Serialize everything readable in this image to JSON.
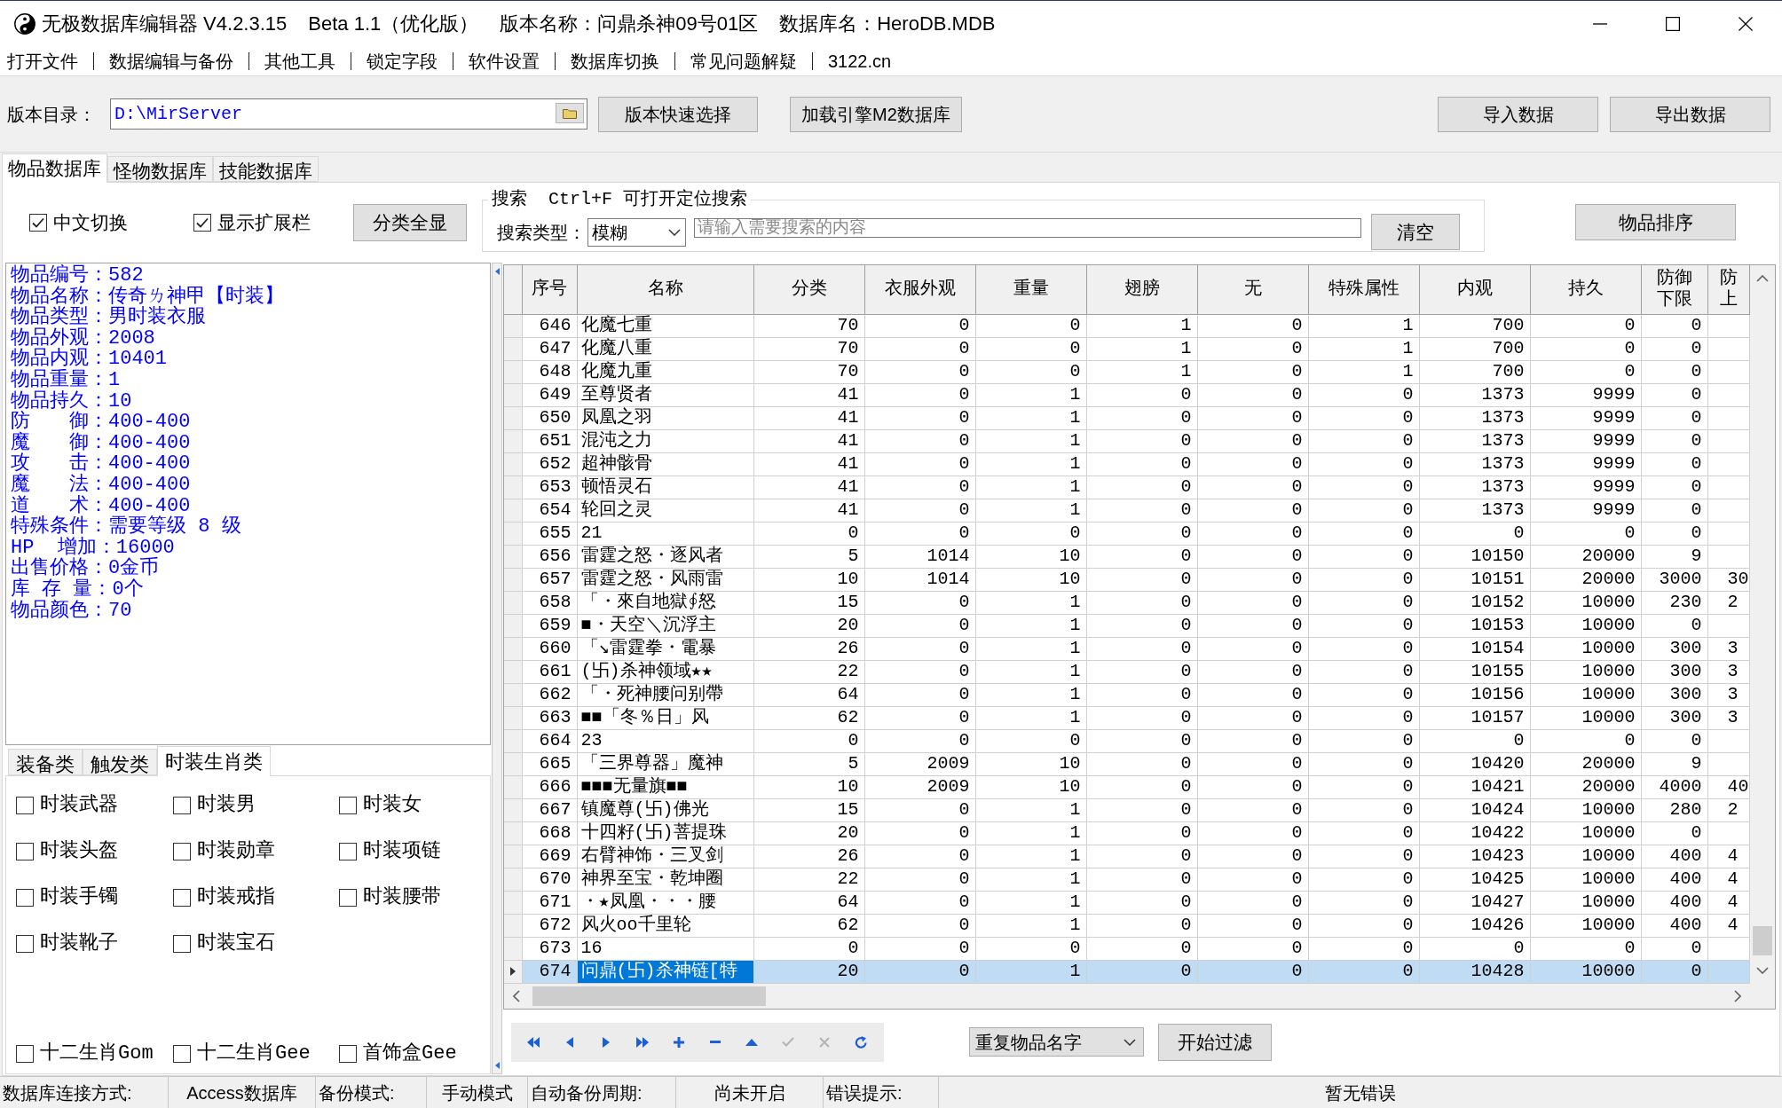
{
  "window": {
    "title_parts": [
      "无极数据库编辑器 V4.2.3.15",
      "Beta 1.1（优化版）",
      "版本名称：问鼎杀神09号01区",
      "数据库名：HeroDB.MDB"
    ]
  },
  "menu": [
    "打开文件",
    "数据编辑与备份",
    "其他工具",
    "锁定字段",
    "软件设置",
    "数据库切换",
    "常见问题解疑",
    "3122.cn"
  ],
  "path_bar": {
    "label": "版本目录：",
    "value": "D:\\MirServer",
    "buttons": [
      "版本快速选择",
      "加载引擎M2数据库"
    ],
    "right_buttons": [
      "导入数据",
      "导出数据"
    ]
  },
  "tabs": [
    {
      "label": "物品数据库",
      "selected": true
    },
    {
      "label": "怪物数据库",
      "selected": false
    },
    {
      "label": "技能数据库",
      "selected": false
    }
  ],
  "options": {
    "checkboxes": [
      {
        "label": "中文切换",
        "checked": true
      },
      {
        "label": "显示扩展栏",
        "checked": true
      }
    ],
    "button": "分类全显"
  },
  "search": {
    "title": "搜索  Ctrl+F 可打开定位搜索",
    "type_label": "搜索类型：",
    "type_value": "模糊",
    "placeholder": "请输入需要搜索的内容",
    "clear_button": "清空"
  },
  "sort_button": "物品排序",
  "item_info": [
    "物品编号：582",
    "物品名称：传奇ㄌ神甲【时装】",
    "物品类型：男时装衣服",
    "物品外观：2008",
    "物品内观：10401",
    "物品重量：1",
    "物品持久：10",
    "防　　御：400-400",
    "魔　　御：400-400",
    "攻　　击：400-400",
    "魔　　法：400-400",
    "道　　术：400-400",
    "特殊条件：需要等级 8 级",
    "HP  增加：16000",
    "出售价格：0金币",
    "库 存 量：0个",
    "物品颜色：70"
  ],
  "category_tabs": [
    {
      "label": "装备类",
      "selected": false
    },
    {
      "label": "触发类",
      "selected": false
    },
    {
      "label": "时装生肖类",
      "selected": true
    }
  ],
  "category_checkbox_groups": [
    [
      {
        "label": "时装武器",
        "checked": false
      },
      {
        "label": "时装男",
        "checked": false
      },
      {
        "label": "时装女",
        "checked": false
      },
      {
        "label": "时装头盔",
        "checked": false
      },
      {
        "label": "时装勋章",
        "checked": false
      },
      {
        "label": "时装项链",
        "checked": false
      },
      {
        "label": "时装手镯",
        "checked": false
      },
      {
        "label": "时装戒指",
        "checked": false
      },
      {
        "label": "时装腰带",
        "checked": false
      },
      {
        "label": "时装靴子",
        "checked": false
      },
      {
        "label": "时装宝石",
        "checked": false
      }
    ],
    [
      {
        "label": "十二生肖Gom",
        "checked": false
      },
      {
        "label": "十二生肖Gee",
        "checked": false
      },
      {
        "label": "首饰盒Gee",
        "checked": false
      }
    ]
  ],
  "table": {
    "columns": [
      {
        "label": "序号",
        "kind": "number"
      },
      {
        "label": "名称",
        "kind": "text"
      },
      {
        "label": "分类",
        "kind": "number"
      },
      {
        "label": "衣服外观",
        "kind": "number"
      },
      {
        "label": "重量",
        "kind": "number"
      },
      {
        "label": "翅膀",
        "kind": "number"
      },
      {
        "label": "无",
        "kind": "number"
      },
      {
        "label": "特殊属性",
        "kind": "number"
      },
      {
        "label": "内观",
        "kind": "number"
      },
      {
        "label": "持久",
        "kind": "number"
      },
      {
        "label": "防御下限",
        "kind": "number"
      },
      {
        "label": "防上",
        "kind": "clipped"
      }
    ],
    "rows": [
      {
        "cells": [
          "646",
          "化魔七重",
          "70",
          "0",
          "0",
          "1",
          "0",
          "1",
          "700",
          "0",
          "0"
        ],
        "selected": false
      },
      {
        "cells": [
          "647",
          "化魔八重",
          "70",
          "0",
          "0",
          "1",
          "0",
          "1",
          "700",
          "0",
          "0"
        ],
        "selected": false
      },
      {
        "cells": [
          "648",
          "化魔九重",
          "70",
          "0",
          "0",
          "1",
          "0",
          "1",
          "700",
          "0",
          "0"
        ],
        "selected": false
      },
      {
        "cells": [
          "649",
          "至尊贤者",
          "41",
          "0",
          "1",
          "0",
          "0",
          "0",
          "1373",
          "9999",
          "0"
        ],
        "selected": false
      },
      {
        "cells": [
          "650",
          "凤凰之羽",
          "41",
          "0",
          "1",
          "0",
          "0",
          "0",
          "1373",
          "9999",
          "0"
        ],
        "selected": false
      },
      {
        "cells": [
          "651",
          "混沌之力",
          "41",
          "0",
          "1",
          "0",
          "0",
          "0",
          "1373",
          "9999",
          "0"
        ],
        "selected": false
      },
      {
        "cells": [
          "652",
          "超神骸骨",
          "41",
          "0",
          "1",
          "0",
          "0",
          "0",
          "1373",
          "9999",
          "0"
        ],
        "selected": false
      },
      {
        "cells": [
          "653",
          "顿悟灵石",
          "41",
          "0",
          "1",
          "0",
          "0",
          "0",
          "1373",
          "9999",
          "0"
        ],
        "selected": false
      },
      {
        "cells": [
          "654",
          "轮回之灵",
          "41",
          "0",
          "1",
          "0",
          "0",
          "0",
          "1373",
          "9999",
          "0"
        ],
        "selected": false
      },
      {
        "cells": [
          "655",
          "21",
          "0",
          "0",
          "0",
          "0",
          "0",
          "0",
          "0",
          "0",
          "0"
        ],
        "selected": false
      },
      {
        "cells": [
          "656",
          "雷霆之怒・逐风者",
          "5",
          "1014",
          "10",
          "0",
          "0",
          "0",
          "10150",
          "20000",
          "9"
        ],
        "selected": false
      },
      {
        "cells": [
          "657",
          "雷霆之怒・风雨雷",
          "10",
          "1014",
          "10",
          "0",
          "0",
          "0",
          "10151",
          "20000",
          "3000",
          "30"
        ],
        "selected": false
      },
      {
        "cells": [
          "658",
          "「・來自地獄∮怒",
          "15",
          "0",
          "1",
          "0",
          "0",
          "0",
          "10152",
          "10000",
          "230",
          "2"
        ],
        "selected": false
      },
      {
        "cells": [
          "659",
          "■・天空＼沉浮主",
          "20",
          "0",
          "1",
          "0",
          "0",
          "0",
          "10153",
          "10000",
          "0"
        ],
        "selected": false
      },
      {
        "cells": [
          "660",
          "「↘雷霆拳・電暴",
          "26",
          "0",
          "1",
          "0",
          "0",
          "0",
          "10154",
          "10000",
          "300",
          "3"
        ],
        "selected": false
      },
      {
        "cells": [
          "661",
          "(卐)杀神领域★★",
          "22",
          "0",
          "1",
          "0",
          "0",
          "0",
          "10155",
          "10000",
          "300",
          "3"
        ],
        "selected": false
      },
      {
        "cells": [
          "662",
          "「・死神腰问别帶",
          "64",
          "0",
          "1",
          "0",
          "0",
          "0",
          "10156",
          "10000",
          "300",
          "3"
        ],
        "selected": false
      },
      {
        "cells": [
          "663",
          "■■「冬％日」风",
          "62",
          "0",
          "1",
          "0",
          "0",
          "0",
          "10157",
          "10000",
          "300",
          "3"
        ],
        "selected": false
      },
      {
        "cells": [
          "664",
          "23",
          "0",
          "0",
          "0",
          "0",
          "0",
          "0",
          "0",
          "0",
          "0"
        ],
        "selected": false
      },
      {
        "cells": [
          "665",
          "「三界尊器」魔神",
          "5",
          "2009",
          "10",
          "0",
          "0",
          "0",
          "10420",
          "20000",
          "9"
        ],
        "selected": false
      },
      {
        "cells": [
          "666",
          "■■■无量旗■■",
          "10",
          "2009",
          "10",
          "0",
          "0",
          "0",
          "10421",
          "20000",
          "4000",
          "40"
        ],
        "selected": false
      },
      {
        "cells": [
          "667",
          "镇魔尊(卐)佛光",
          "15",
          "0",
          "1",
          "0",
          "0",
          "0",
          "10424",
          "10000",
          "280",
          "2"
        ],
        "selected": false
      },
      {
        "cells": [
          "668",
          "十四籽(卐)菩提珠",
          "20",
          "0",
          "1",
          "0",
          "0",
          "0",
          "10422",
          "10000",
          "0"
        ],
        "selected": false
      },
      {
        "cells": [
          "669",
          "右臂神饰・三叉剑",
          "26",
          "0",
          "1",
          "0",
          "0",
          "0",
          "10423",
          "10000",
          "400",
          "4"
        ],
        "selected": false
      },
      {
        "cells": [
          "670",
          "神界至宝・乾坤圈",
          "22",
          "0",
          "1",
          "0",
          "0",
          "0",
          "10425",
          "10000",
          "400",
          "4"
        ],
        "selected": false
      },
      {
        "cells": [
          "671",
          "・★凤凰・・・腰",
          "64",
          "0",
          "1",
          "0",
          "0",
          "0",
          "10427",
          "10000",
          "400",
          "4"
        ],
        "selected": false
      },
      {
        "cells": [
          "672",
          "风火oo千里轮",
          "62",
          "0",
          "1",
          "0",
          "0",
          "0",
          "10426",
          "10000",
          "400",
          "4"
        ],
        "selected": false
      },
      {
        "cells": [
          "673",
          "16",
          "0",
          "0",
          "0",
          "0",
          "0",
          "0",
          "0",
          "0",
          "0"
        ],
        "selected": false
      },
      {
        "cells": [
          "674",
          "问鼎(卐)杀神链[特",
          "20",
          "0",
          "1",
          "0",
          "0",
          "0",
          "10428",
          "10000",
          "0"
        ],
        "selected": true
      }
    ]
  },
  "navigator": [
    {
      "kind": "first",
      "disabled": false
    },
    {
      "kind": "prior",
      "disabled": false
    },
    {
      "kind": "next",
      "disabled": false
    },
    {
      "kind": "last",
      "disabled": false
    },
    {
      "kind": "insert",
      "disabled": false
    },
    {
      "kind": "delete",
      "disabled": false
    },
    {
      "kind": "edit",
      "disabled": false
    },
    {
      "kind": "post",
      "disabled": true
    },
    {
      "kind": "cancel",
      "disabled": true
    },
    {
      "kind": "refresh",
      "disabled": false
    }
  ],
  "filter": {
    "value": "重复物品名字",
    "button": "开始过滤"
  },
  "status_bar": [
    {
      "label": "数据库连接方式:",
      "value": "Access数据库"
    },
    {
      "label": "备份模式:",
      "value": "手动模式"
    },
    {
      "label": "自动备份周期:",
      "value": "尚未开启"
    },
    {
      "label": "错误提示:",
      "value": "暂无错误"
    }
  ]
}
